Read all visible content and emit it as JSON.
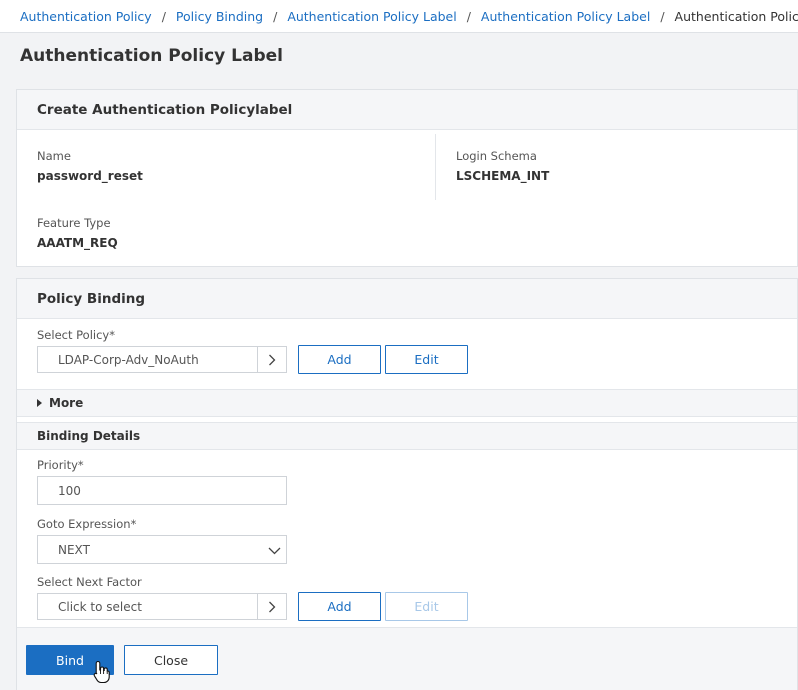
{
  "breadcrumb": [
    {
      "label": "Authentication Policy",
      "link": true
    },
    {
      "label": "Policy Binding",
      "link": true
    },
    {
      "label": "Authentication Policy Label",
      "link": true
    },
    {
      "label": "Authentication Policy Label",
      "link": true
    },
    {
      "label": "Authentication Policy Label",
      "link": false
    }
  ],
  "page": {
    "title": "Authentication Policy Label"
  },
  "create_panel": {
    "title": "Create Authentication Policylabel",
    "name_label": "Name",
    "name_value": "password_reset",
    "schema_label": "Login Schema",
    "schema_value": "LSCHEMA_INT",
    "feature_label": "Feature Type",
    "feature_value": "AAATM_REQ"
  },
  "binding_panel": {
    "title": "Policy Binding",
    "select_policy_label": "Select Policy*",
    "select_policy_value": "LDAP-Corp-Adv_NoAuth",
    "add_label": "Add",
    "edit_label": "Edit",
    "more_label": "More",
    "details_label": "Binding Details",
    "priority_label": "Priority*",
    "priority_value": "100",
    "goto_label": "Goto Expression*",
    "goto_value": "NEXT",
    "next_factor_label": "Select Next Factor",
    "next_factor_placeholder": "Click to select",
    "add2_label": "Add",
    "edit2_label": "Edit",
    "edit2_disabled": true
  },
  "footer": {
    "bind_label": "Bind",
    "close_label": "Close"
  },
  "colors": {
    "accent": "#1b6ec2",
    "disabled": "#a8c8e8",
    "panel_header": "#f5f6f8",
    "page_bg": "#f2f3f5"
  },
  "icons": [
    "chevron-right-icon",
    "chevron-down-icon",
    "caret-right-icon",
    "hand-cursor-icon"
  ]
}
